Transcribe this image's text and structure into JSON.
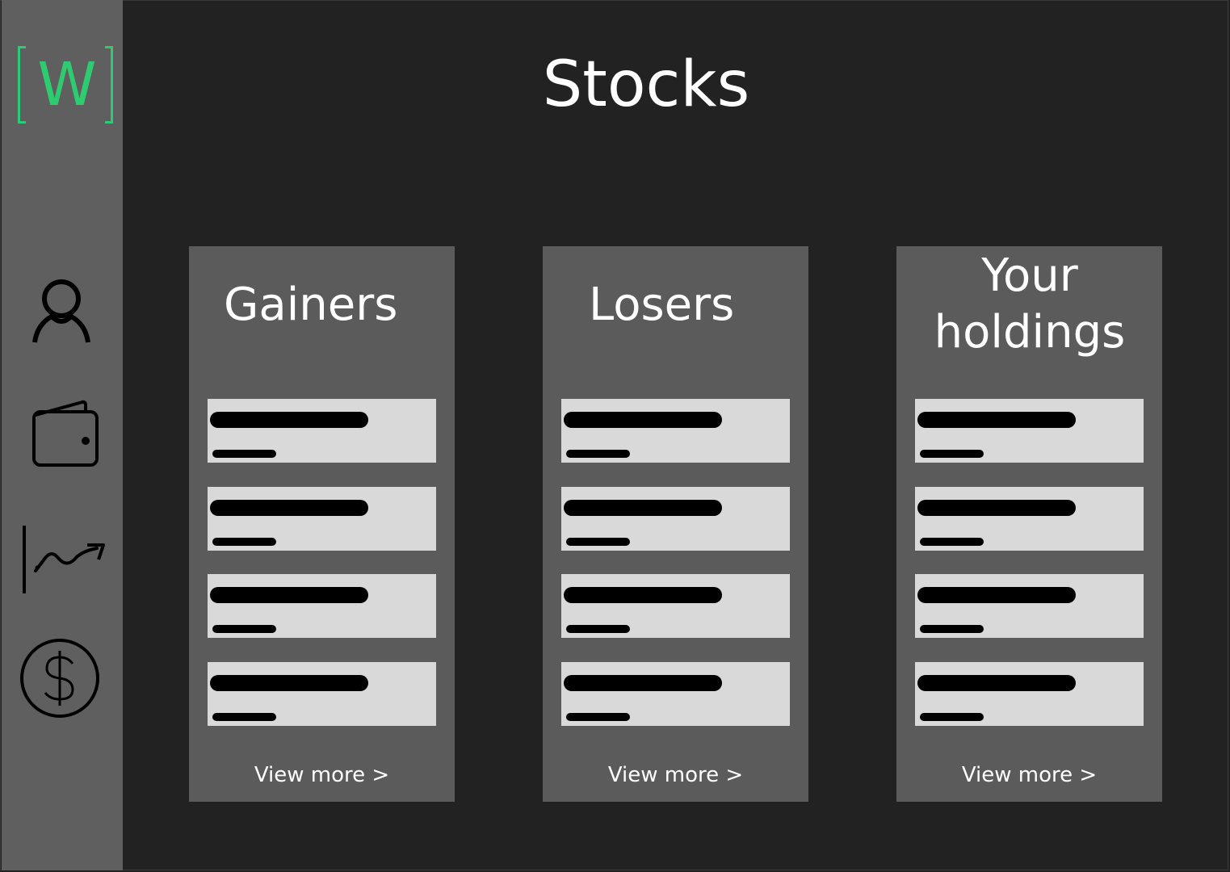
{
  "app": {
    "logo_letter": "W",
    "accent_color": "#2ecc71"
  },
  "page": {
    "title": "Stocks"
  },
  "sidebar": {
    "items": [
      {
        "icon": "user-icon"
      },
      {
        "icon": "wallet-icon"
      },
      {
        "icon": "chart-trend-icon"
      },
      {
        "icon": "dollar-icon"
      }
    ]
  },
  "cards": [
    {
      "title": "Gainers",
      "view_more": "View more >"
    },
    {
      "title": "Losers",
      "view_more": "View more >"
    },
    {
      "title": "Your holdings",
      "view_more": "View more >"
    }
  ]
}
